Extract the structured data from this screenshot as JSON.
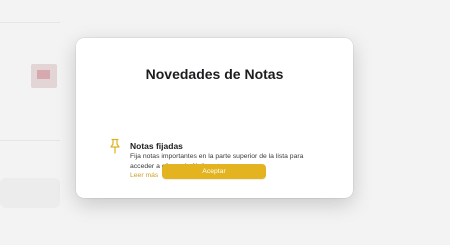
{
  "background": {
    "top_text": "...",
    "left_texts": [
      "...",
      "..."
    ]
  },
  "dialog": {
    "title": "Novedades de Notas",
    "feature": {
      "icon": "pin-icon",
      "title": "Notas fijadas",
      "description": "Fija notas importantes en la parte superior de la lista para acceder a ellas más fácilmente.",
      "learn_more": "Leer más"
    },
    "accept_label": "Aceptar"
  },
  "colors": {
    "accent": "#e3b420",
    "link": "#c9a22a",
    "title": "#1d1d1f"
  }
}
